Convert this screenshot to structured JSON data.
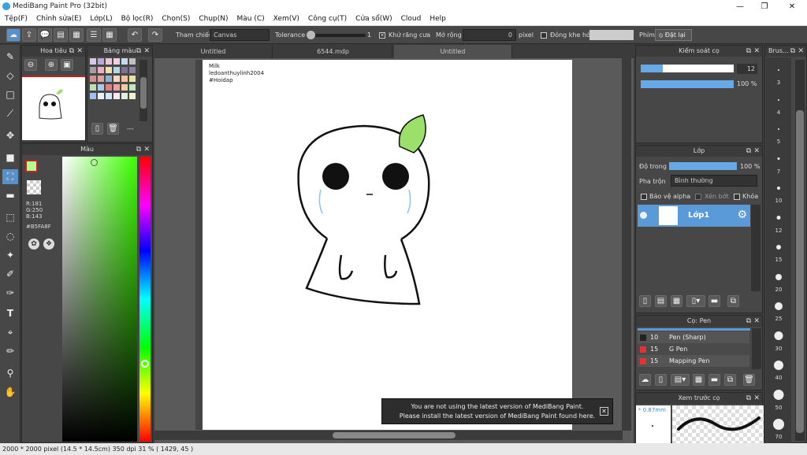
{
  "window": {
    "title": "MediBang Paint Pro (32bit)",
    "min": "—",
    "max": "❐",
    "close": "✕"
  },
  "menu": [
    "Tệp(F)",
    "Chỉnh sửa(E)",
    "Lớp(L)",
    "Bộ lọc(R)",
    "Chọn(S)",
    "Chụp(N)",
    "Màu (C)",
    "Xem(V)",
    "Công cụ(T)",
    "Cửa sổ(W)",
    "Cloud",
    "Help"
  ],
  "toolbar": {
    "reference_label": "Tham chiếu",
    "reference_value": "Canvas",
    "tolerance_label": "Tolerance",
    "tolerance_value": "1",
    "antialias_label": "Khử răng cưa",
    "expand_label": "Mở rộng",
    "expand_value": "0",
    "expand_unit": "pixel",
    "close_gap_label": "Đóng khe hở",
    "key_label": "Phím",
    "reset_label": "Đặt lại"
  },
  "navigator": {
    "title": "Hoa tiêu"
  },
  "palette_panel": {
    "title": "Bảng màu",
    "extra": "---"
  },
  "color_panel": {
    "title": "Màu",
    "r": "R:181",
    "g": "G:250",
    "b": "B:143",
    "hex": "#B5FA8F",
    "current_color": "#B5FA8F"
  },
  "tabs": [
    "Untitled",
    "6544.mdp",
    "Untitled"
  ],
  "canvas_text": {
    "line1": "Milk",
    "line2": "ledoanthuylinh2004",
    "line3": "#Hoidap"
  },
  "brush_control": {
    "title": "Kiểm soát cọ",
    "size": "12",
    "opacity": "100 %"
  },
  "layer_panel": {
    "title": "Lớp",
    "opacity_label": "Độ trong",
    "opacity_value": "100 %",
    "blend_label": "Pha trộn",
    "blend_value": "Bình thường",
    "protect_alpha": "Bảo vệ alpha",
    "clipping": "Xén bớt",
    "lock": "Khóa",
    "layer_name": "Lớp1"
  },
  "brush_panel": {
    "title": "Cọ: Pen",
    "items": [
      {
        "size": "10",
        "name": "Pen (Sharp)",
        "color": "#222222"
      },
      {
        "size": "15",
        "name": "G Pen",
        "color": "#e83030"
      },
      {
        "size": "15",
        "name": "Mapping Pen",
        "color": "#e83030"
      }
    ]
  },
  "preview_panel": {
    "title": "Xem trước cọ",
    "size": "* 0.87mm"
  },
  "brush_strip": {
    "title": "Brus...",
    "sizes": [
      "3",
      "4",
      "5",
      "7",
      "10",
      "12",
      "15",
      "20",
      "25",
      "30",
      "40",
      "50",
      "70"
    ]
  },
  "toast": {
    "line1": "You are not using the latest version of MediBang Paint.",
    "line2": "Please install the latest version of MediBang Paint found here."
  },
  "status": {
    "text": "2000 * 2000 pixel   (14.5 * 14.5cm)   350 dpi   31 %   ( 1429, 45 )"
  },
  "colors": {
    "accent": "#5a90c8",
    "bg": "#474747",
    "dark": "#3b3b3b"
  }
}
